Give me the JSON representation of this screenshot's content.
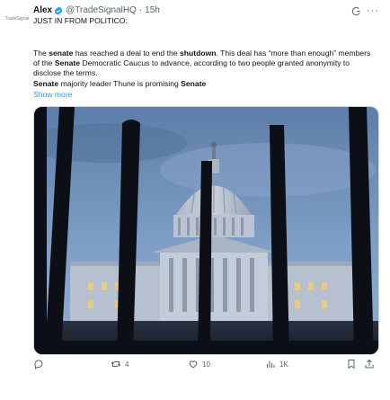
{
  "author": {
    "avatar_text": "TradeSignal",
    "name": "Alex",
    "handle": "@TradeSignalHQ",
    "time": "15h"
  },
  "tweet": {
    "line1": "JUST IN FROM POLITICO:",
    "para2": {
      "s1": "The ",
      "senate1": "senate",
      "s2": " has reached a deal to end the ",
      "shutdown": "shutdown",
      "s3": ". This deal has “more than enough” members of the ",
      "senate2": "Senate",
      "s4": " Democratic Caucus to advance, according to two people granted anonymity to disclose the terms."
    },
    "para3": {
      "senate1": "Senate",
      "s1": " majority leader Thune is promising ",
      "senate2": "Senate"
    },
    "show_more": "Show more"
  },
  "actions": {
    "reply_count": "",
    "retweet_count": "4",
    "like_count": "10",
    "views_count": "1K"
  },
  "colors": {
    "accent": "#1d9bf0",
    "text": "#0f1419",
    "muted": "#536471"
  },
  "icons": [
    "verified-badge-icon",
    "grok-icon",
    "more-icon",
    "reply-icon",
    "retweet-icon",
    "like-icon",
    "views-icon",
    "bookmark-icon",
    "share-icon"
  ]
}
